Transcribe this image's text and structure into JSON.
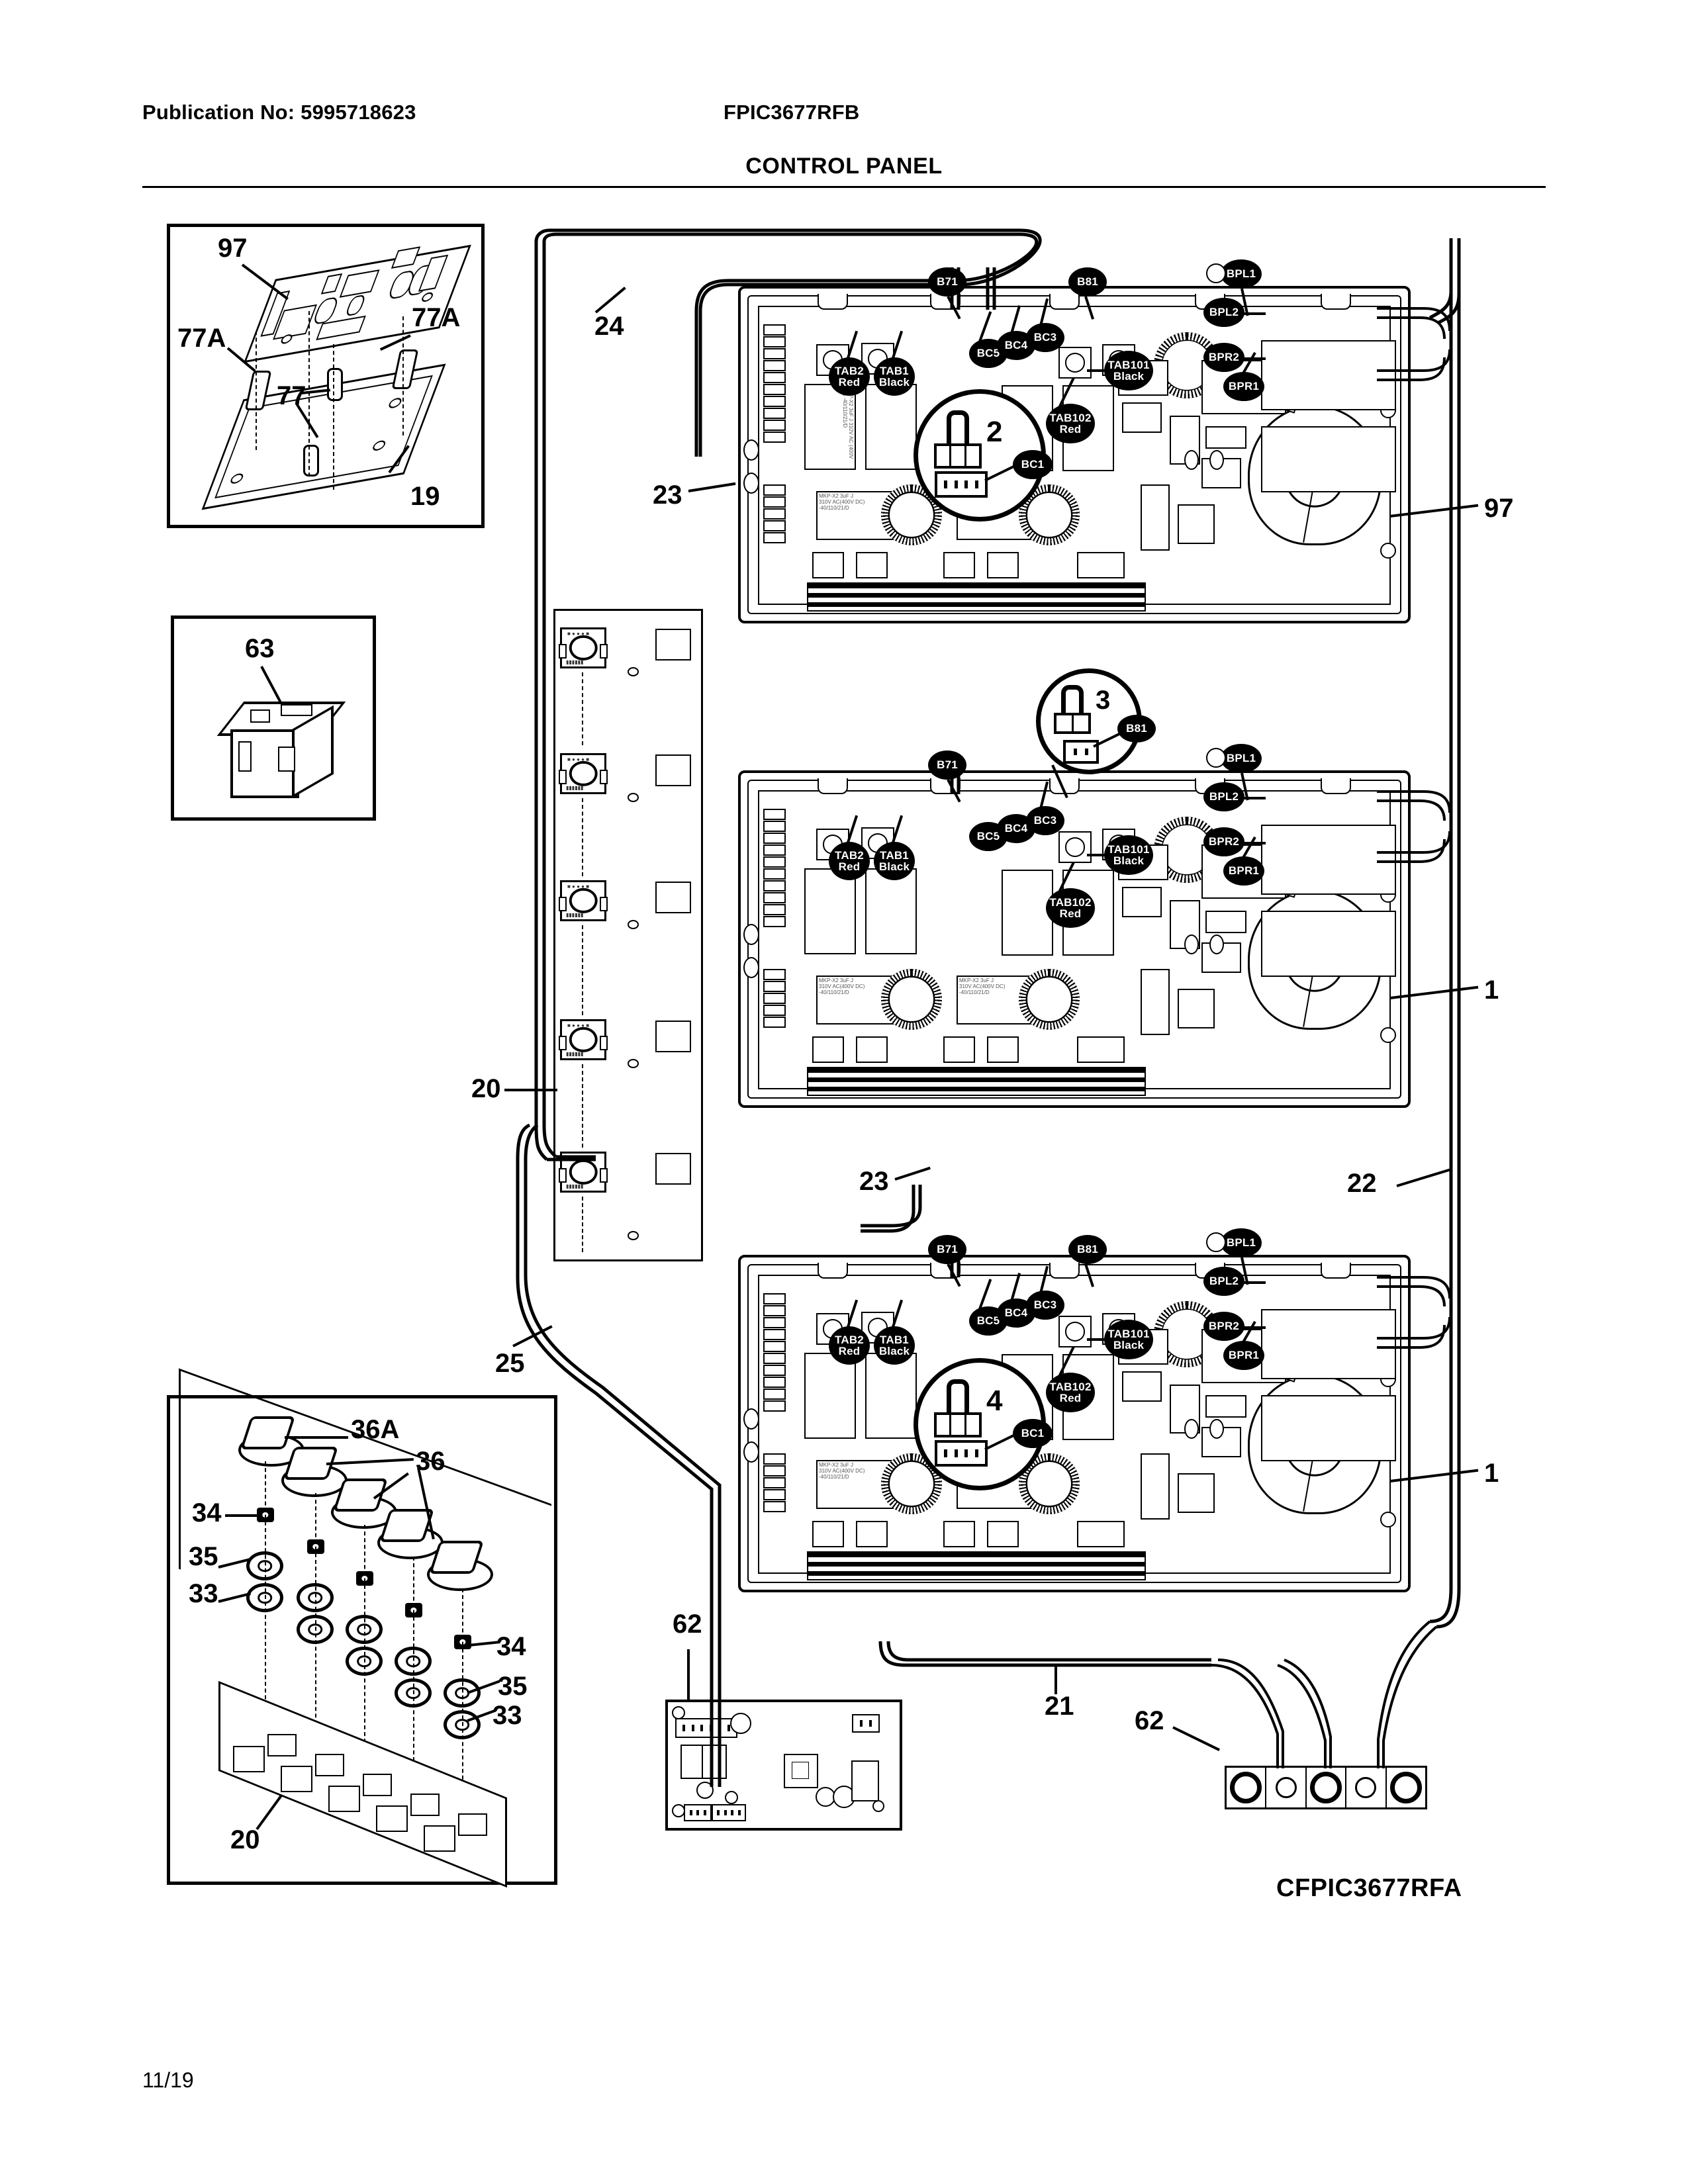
{
  "document": {
    "publication_label": "Publication No: 5995718623",
    "model": "FPIC3677RFB",
    "section_title": "CONTROL PANEL",
    "diagram_code": "CFPIC3677RFA",
    "page_number": "11/19"
  },
  "insets": {
    "power_board": {
      "callouts": [
        {
          "id": "97",
          "label": "97"
        },
        {
          "id": "77A_left",
          "label": "77A"
        },
        {
          "id": "77A_right",
          "label": "77A"
        },
        {
          "id": "77",
          "label": "77"
        },
        {
          "id": "19",
          "label": "19"
        }
      ]
    },
    "relay": {
      "callouts": [
        {
          "id": "63",
          "label": "63"
        }
      ]
    },
    "knob_panel": {
      "callouts": [
        {
          "id": "36A",
          "label": "36A"
        },
        {
          "id": "36",
          "label": "36"
        },
        {
          "id": "34_left",
          "label": "34"
        },
        {
          "id": "34_right",
          "label": "34"
        },
        {
          "id": "35_left",
          "label": "35"
        },
        {
          "id": "35_right",
          "label": "35"
        },
        {
          "id": "33_left",
          "label": "33"
        },
        {
          "id": "33_right",
          "label": "33"
        },
        {
          "id": "20",
          "label": "20"
        }
      ]
    }
  },
  "main_callouts": [
    {
      "id": "24",
      "label": "24"
    },
    {
      "id": "23_top",
      "label": "23"
    },
    {
      "id": "23_mid",
      "label": "23"
    },
    {
      "id": "20_strip",
      "label": "20"
    },
    {
      "id": "25",
      "label": "25"
    },
    {
      "id": "22",
      "label": "22"
    },
    {
      "id": "21",
      "label": "21"
    },
    {
      "id": "62",
      "label": "62"
    },
    {
      "id": "97_bottom",
      "label": "97"
    },
    {
      "id": "1_top",
      "label": "1"
    },
    {
      "id": "1_mid",
      "label": "1"
    },
    {
      "id": "1_bottom",
      "label": "1"
    }
  ],
  "magnifiers": [
    {
      "id": "detail_2",
      "number": "2",
      "tag": "BC1"
    },
    {
      "id": "detail_3",
      "number": "3",
      "tag": "B81"
    },
    {
      "id": "detail_4",
      "number": "4",
      "tag": "BC1"
    }
  ],
  "modules": [
    {
      "id": "module_top",
      "tags": [
        {
          "name": "B71",
          "line1": "B71",
          "line2": ""
        },
        {
          "name": "B81",
          "line1": "B81",
          "line2": ""
        },
        {
          "name": "BC5",
          "line1": "BC5",
          "line2": ""
        },
        {
          "name": "BC4",
          "line1": "BC4",
          "line2": ""
        },
        {
          "name": "BC3",
          "line1": "BC3",
          "line2": ""
        },
        {
          "name": "BC1",
          "line1": "BC1",
          "line2": ""
        },
        {
          "name": "TAB2",
          "line1": "TAB2",
          "line2": "Red"
        },
        {
          "name": "TAB1",
          "line1": "TAB1",
          "line2": "Black"
        },
        {
          "name": "TAB101",
          "line1": "TAB101",
          "line2": "Black"
        },
        {
          "name": "TAB102",
          "line1": "TAB102",
          "line2": "Red"
        },
        {
          "name": "BPL1",
          "line1": "BPL1",
          "line2": ""
        },
        {
          "name": "BPL2",
          "line1": "BPL2",
          "line2": ""
        },
        {
          "name": "BPR2",
          "line1": "BPR2",
          "line2": ""
        },
        {
          "name": "BPR1",
          "line1": "BPR1",
          "line2": ""
        }
      ],
      "cap_text": "MKP-X2 3uF J\n310V AC (400V DC)\n-40/110/21/D"
    },
    {
      "id": "module_middle",
      "tags": [
        {
          "name": "B71",
          "line1": "B71",
          "line2": ""
        },
        {
          "name": "BC5",
          "line1": "BC5",
          "line2": ""
        },
        {
          "name": "BC4",
          "line1": "BC4",
          "line2": ""
        },
        {
          "name": "BC3",
          "line1": "BC3",
          "line2": ""
        },
        {
          "name": "TAB2",
          "line1": "TAB2",
          "line2": "Red"
        },
        {
          "name": "TAB1",
          "line1": "TAB1",
          "line2": "Black"
        },
        {
          "name": "TAB101",
          "line1": "TAB101",
          "line2": "Black"
        },
        {
          "name": "TAB102",
          "line1": "TAB102",
          "line2": "Red"
        },
        {
          "name": "BPL1",
          "line1": "BPL1",
          "line2": ""
        },
        {
          "name": "BPL2",
          "line1": "BPL2",
          "line2": ""
        },
        {
          "name": "BPR2",
          "line1": "BPR2",
          "line2": ""
        },
        {
          "name": "BPR1",
          "line1": "BPR1",
          "line2": ""
        }
      ]
    },
    {
      "id": "module_bottom",
      "tags": [
        {
          "name": "B71",
          "line1": "B71",
          "line2": ""
        },
        {
          "name": "B81",
          "line1": "B81",
          "line2": ""
        },
        {
          "name": "BC5",
          "line1": "BC5",
          "line2": ""
        },
        {
          "name": "BC4",
          "line1": "BC4",
          "line2": ""
        },
        {
          "name": "BC3",
          "line1": "BC3",
          "line2": ""
        },
        {
          "name": "BC1",
          "line1": "BC1",
          "line2": ""
        },
        {
          "name": "TAB2",
          "line1": "TAB2",
          "line2": "Red"
        },
        {
          "name": "TAB1",
          "line1": "TAB1",
          "line2": "Black"
        },
        {
          "name": "TAB101",
          "line1": "TAB101",
          "line2": "Black"
        },
        {
          "name": "TAB102",
          "line1": "TAB102",
          "line2": "Red"
        },
        {
          "name": "BPL1",
          "line1": "BPL1",
          "line2": ""
        },
        {
          "name": "BPL2",
          "line1": "BPL2",
          "line2": ""
        },
        {
          "name": "BPR2",
          "line1": "BPR2",
          "line2": ""
        },
        {
          "name": "BPR1",
          "line1": "BPR1",
          "line2": ""
        }
      ]
    }
  ]
}
